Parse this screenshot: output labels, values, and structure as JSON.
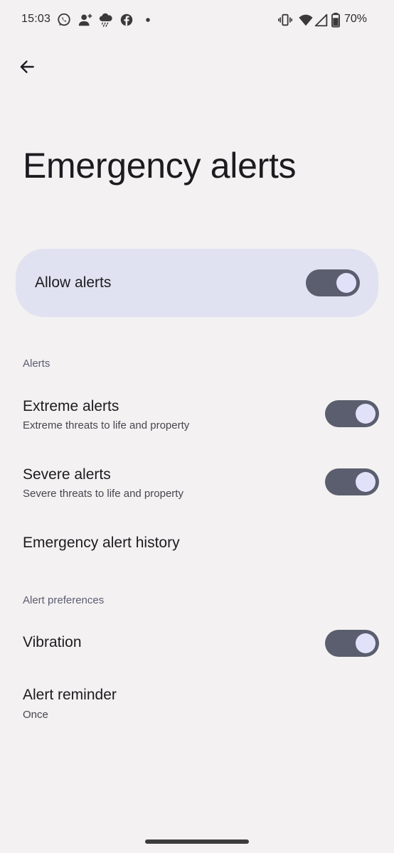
{
  "status_bar": {
    "time": "15:03",
    "battery": "70%",
    "left_icons": [
      "whatsapp-icon",
      "person-add-icon",
      "weather-rain-icon",
      "facebook-icon",
      "dot-icon"
    ],
    "right_icons": [
      "vibrate-icon",
      "wifi-icon",
      "cellular-signal-icon",
      "battery-icon"
    ]
  },
  "header": {
    "back_icon": "arrow-back-icon",
    "title": "Emergency alerts"
  },
  "main_toggle": {
    "label": "Allow alerts",
    "on": true
  },
  "sections": [
    {
      "header": "Alerts",
      "items": [
        {
          "title": "Extreme alerts",
          "subtitle": "Extreme threats to life and property",
          "toggle": true
        },
        {
          "title": "Severe alerts",
          "subtitle": "Severe threats to life and property",
          "toggle": true
        },
        {
          "title": "Emergency alert history"
        }
      ]
    },
    {
      "header": "Alert preferences",
      "items": [
        {
          "title": "Vibration",
          "toggle": true
        },
        {
          "title": "Alert reminder",
          "subtitle": "Once"
        }
      ]
    }
  ],
  "colors": {
    "background": "#f3f1f1",
    "card": "#e1e2f1",
    "switch_track": "#5b5e6e",
    "switch_knob": "#e1e2f9",
    "section_header": "#5c5d72"
  }
}
